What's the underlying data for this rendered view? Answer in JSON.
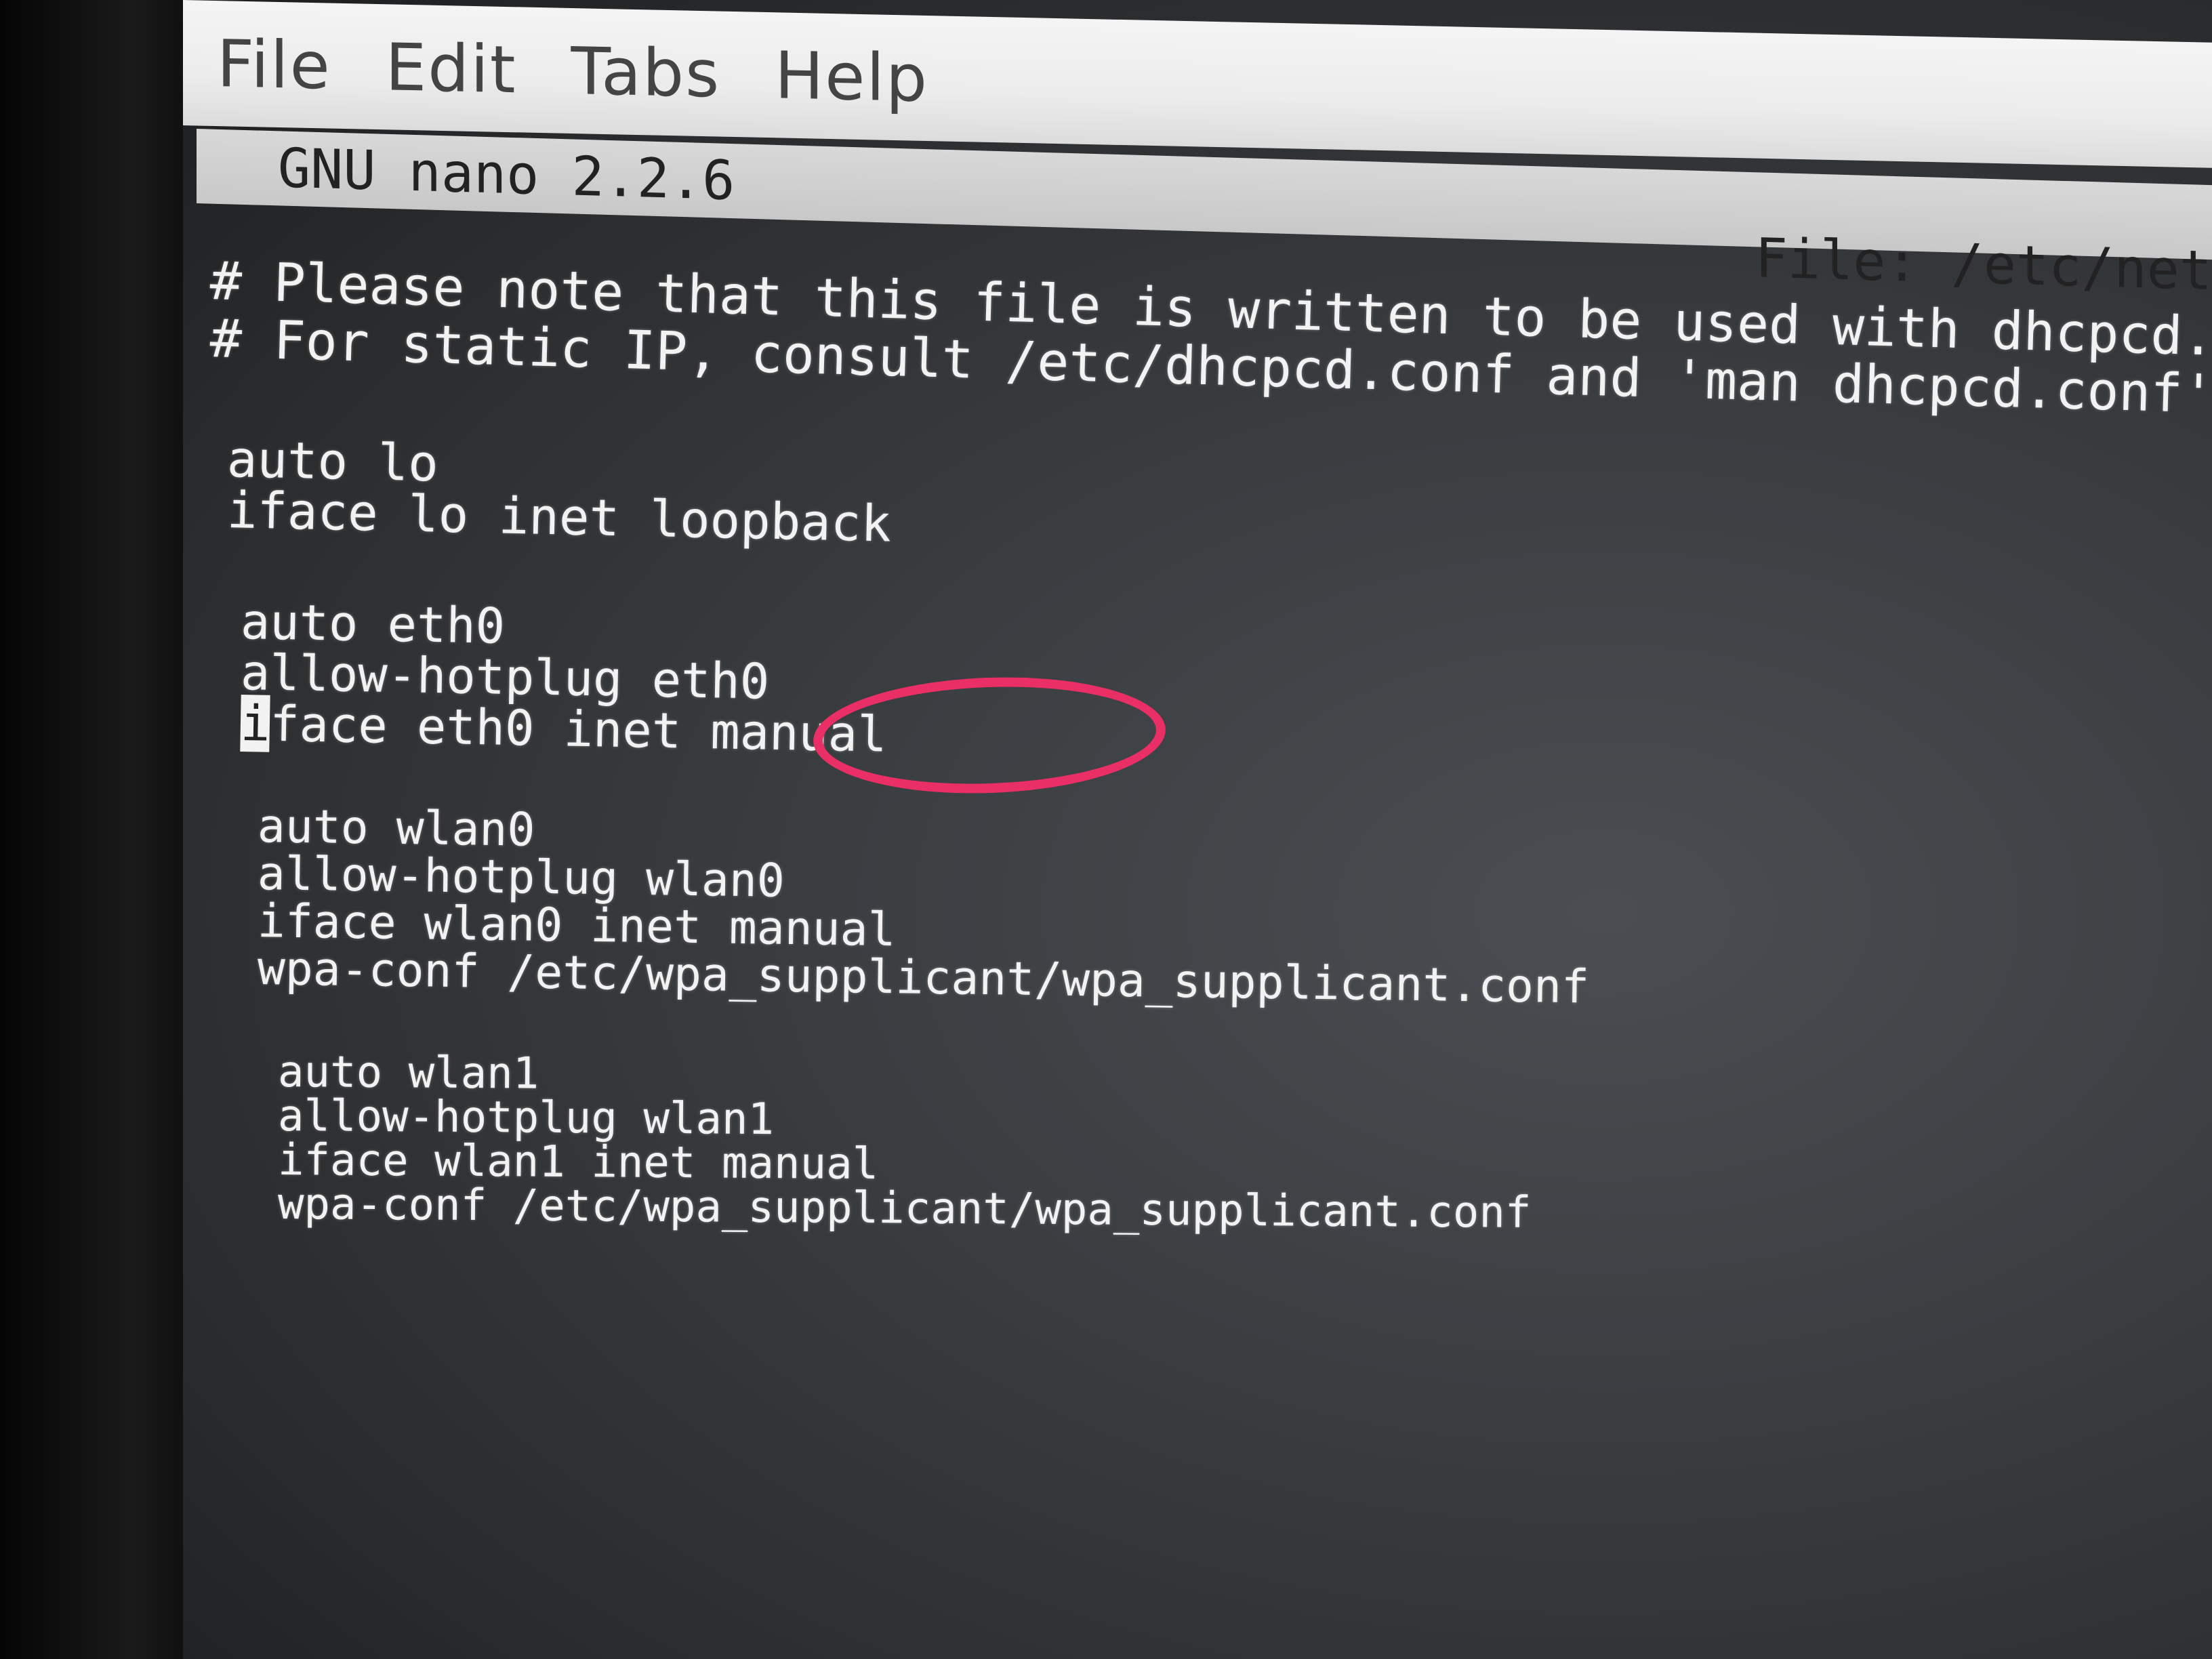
{
  "menu": {
    "items": [
      {
        "label": "File"
      },
      {
        "label": "Edit"
      },
      {
        "label": "Tabs"
      },
      {
        "label": "Help"
      }
    ]
  },
  "nano": {
    "version": "GNU nano 2.2.6",
    "file": "File: /etc/net"
  },
  "buffer": {
    "lines": [
      "# Please note that this file is written to be used with dhcpcd.",
      "# For static IP, consult /etc/dhcpcd.conf and 'man dhcpcd.conf'.",
      "auto lo",
      "iface lo inet loopback",
      "auto eth0",
      "allow-hotplug eth0",
      "face eth0 inet manual",
      "auto wlan0",
      "allow-hotplug wlan0",
      "iface wlan0 inet manual",
      "wpa-conf /etc/wpa_supplicant/wpa_supplicant.conf",
      "auto wlan1",
      "allow-hotplug wlan1",
      "iface wlan1 inet manual",
      "wpa-conf /etc/wpa_supplicant/wpa_supplicant.conf"
    ],
    "cursor_char": "i"
  },
  "colors": {
    "annotation_ring": "#ea2f66",
    "terminal_bg": "#3a3d40",
    "terminal_text": "#f2f2f2"
  }
}
